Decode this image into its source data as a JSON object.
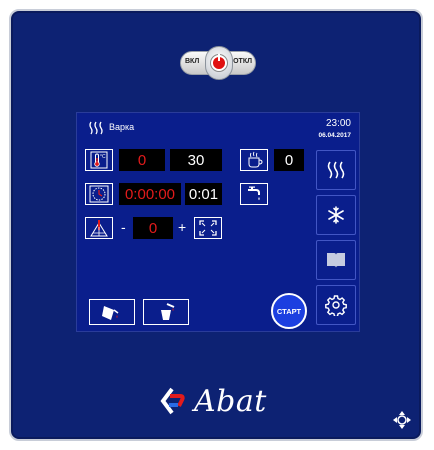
{
  "power_switch": {
    "on_label": "ВКЛ",
    "off_label": "ОТКЛ"
  },
  "header": {
    "mode_title": "Варка",
    "time": "23:00",
    "date": "06.04.2017"
  },
  "rows": {
    "temperature": {
      "set_value": "0",
      "actual_value": "30"
    },
    "timer": {
      "set_time": "0:00:00",
      "elapsed_time": "0:01"
    },
    "fan": {
      "minus_label": "-",
      "value": "0",
      "plus_label": "+"
    },
    "humidity": {
      "value": "0"
    }
  },
  "start_label": "СТАРТ",
  "brand": {
    "name": "Abat"
  },
  "colors": {
    "panel": "#0d2273",
    "screen": "#0a1e8c",
    "value_box": "#000000",
    "set_value_text": "#e31b1b",
    "start_button": "#1c3fe0",
    "power_led": "#e01010"
  },
  "icons": {
    "mode": "steam-icon",
    "temperature": "thermometer-icon",
    "timer": "clock-icon",
    "fan": "fan-speed-icon",
    "fullscreen": "expand-icon",
    "humidity": "steam-cup-icon",
    "water": "water-tap-icon",
    "side_buttons": [
      "steam-icon",
      "snowflake-icon",
      "book-icon",
      "gear-icon"
    ],
    "bottom_buttons": [
      "pour-out-icon",
      "pour-in-icon"
    ],
    "corner": "move-arrows-icon"
  }
}
